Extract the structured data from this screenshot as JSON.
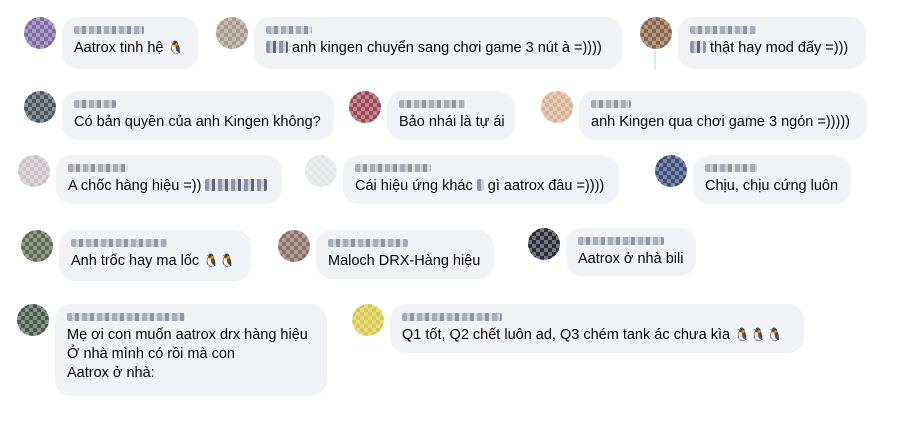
{
  "comments": [
    {
      "text": "Aatrox tinh hệ ",
      "emoji": "🐧"
    },
    {
      "text": "anh kingen chuyển sang chơi game 3 nút à =))))"
    },
    {
      "text": "thật hay mod đấy =)))"
    },
    {
      "text": "Có bản quyền của anh Kingen không?"
    },
    {
      "text": "Bảo nhái là tự ái"
    },
    {
      "text": "anh Kingen qua chơi game 3 ngón =)))))"
    },
    {
      "text": "A chốc hàng hiệu =))"
    },
    {
      "text_a": "Cái hiệu ứng khác",
      "text_b": "gì aatrox đâu =))))"
    },
    {
      "text": "Chịu, chịu cứng luôn"
    },
    {
      "text": "Anh trốc hay ma lốc ",
      "emoji": "🐧🐧"
    },
    {
      "text": "Maloch DRX-Hàng hiệu"
    },
    {
      "text": "Aatrox ở nhà bili"
    },
    {
      "text": "Mẹ ơi con muốn aatrox drx hàng hiệu\nỞ nhà mình có rồi mà con\nAatrox ở nhà:"
    },
    {
      "text": "Q1 tốt, Q2 chết luôn ad, Q3 chém tank ác chưa kìa ",
      "emoji": "🐧🐧🐧"
    }
  ],
  "colors": {
    "bubble": "#f0f2f5",
    "text": "#050505"
  }
}
